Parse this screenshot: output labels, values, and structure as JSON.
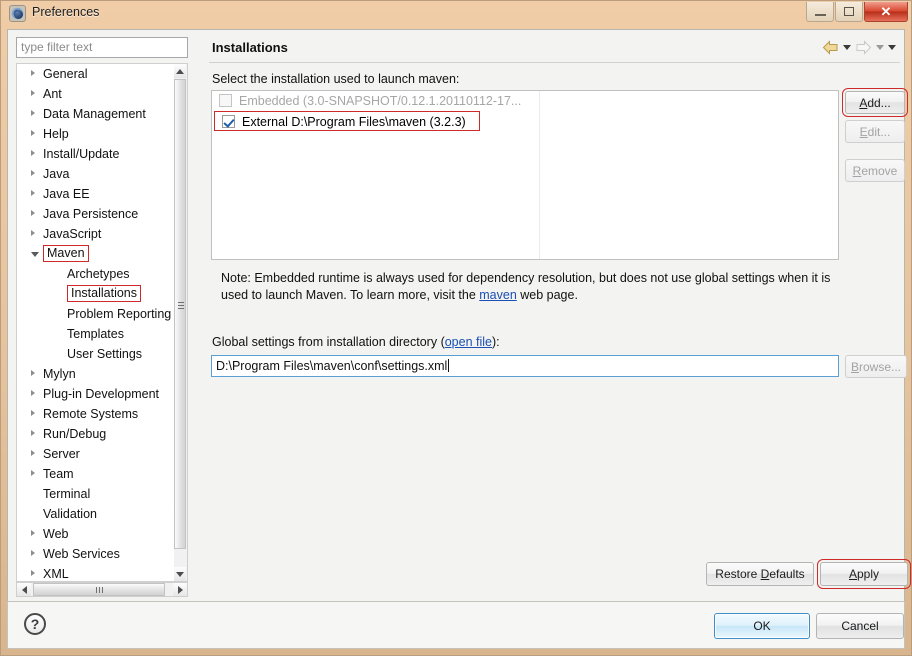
{
  "window": {
    "title": "Preferences",
    "icon": "preferences-icon",
    "minimize_label": "Minimize",
    "maximize_label": "Maximize",
    "close_label": "✕"
  },
  "sidebar": {
    "filter": {
      "placeholder": "type filter text",
      "value": ""
    },
    "tree": [
      {
        "label": "General",
        "indent": 0,
        "expandable": true,
        "expanded": false,
        "marked": false
      },
      {
        "label": "Ant",
        "indent": 0,
        "expandable": true,
        "expanded": false,
        "marked": false
      },
      {
        "label": "Data Management",
        "indent": 0,
        "expandable": true,
        "expanded": false,
        "marked": false
      },
      {
        "label": "Help",
        "indent": 0,
        "expandable": true,
        "expanded": false,
        "marked": false
      },
      {
        "label": "Install/Update",
        "indent": 0,
        "expandable": true,
        "expanded": false,
        "marked": false
      },
      {
        "label": "Java",
        "indent": 0,
        "expandable": true,
        "expanded": false,
        "marked": false
      },
      {
        "label": "Java EE",
        "indent": 0,
        "expandable": true,
        "expanded": false,
        "marked": false
      },
      {
        "label": "Java Persistence",
        "indent": 0,
        "expandable": true,
        "expanded": false,
        "marked": false
      },
      {
        "label": "JavaScript",
        "indent": 0,
        "expandable": true,
        "expanded": false,
        "marked": false
      },
      {
        "label": "Maven",
        "indent": 0,
        "expandable": true,
        "expanded": true,
        "marked": true
      },
      {
        "label": "Archetypes",
        "indent": 1,
        "expandable": false,
        "expanded": false,
        "marked": false
      },
      {
        "label": "Installations",
        "indent": 1,
        "expandable": false,
        "expanded": false,
        "marked": true
      },
      {
        "label": "Problem Reporting",
        "indent": 1,
        "expandable": false,
        "expanded": false,
        "marked": false
      },
      {
        "label": "Templates",
        "indent": 1,
        "expandable": false,
        "expanded": false,
        "marked": false
      },
      {
        "label": "User Settings",
        "indent": 1,
        "expandable": false,
        "expanded": false,
        "marked": false
      },
      {
        "label": "Mylyn",
        "indent": 0,
        "expandable": true,
        "expanded": false,
        "marked": false
      },
      {
        "label": "Plug-in Development",
        "indent": 0,
        "expandable": true,
        "expanded": false,
        "marked": false
      },
      {
        "label": "Remote Systems",
        "indent": 0,
        "expandable": true,
        "expanded": false,
        "marked": false
      },
      {
        "label": "Run/Debug",
        "indent": 0,
        "expandable": true,
        "expanded": false,
        "marked": false
      },
      {
        "label": "Server",
        "indent": 0,
        "expandable": true,
        "expanded": false,
        "marked": false
      },
      {
        "label": "Team",
        "indent": 0,
        "expandable": true,
        "expanded": false,
        "marked": false
      },
      {
        "label": "Terminal",
        "indent": 0,
        "expandable": false,
        "expanded": false,
        "marked": false
      },
      {
        "label": "Validation",
        "indent": 0,
        "expandable": false,
        "expanded": false,
        "marked": false
      },
      {
        "label": "Web",
        "indent": 0,
        "expandable": true,
        "expanded": false,
        "marked": false
      },
      {
        "label": "Web Services",
        "indent": 0,
        "expandable": true,
        "expanded": false,
        "marked": false
      },
      {
        "label": "XML",
        "indent": 0,
        "expandable": true,
        "expanded": false,
        "marked": false
      }
    ]
  },
  "page": {
    "title": "Installations",
    "nav": {
      "back_icon": "back-arrow-icon",
      "back_menu_icon": "chevron-down-icon",
      "forward_icon": "forward-arrow-icon",
      "forward_menu_icon": "chevron-down-icon",
      "menu_icon": "chevron-down-icon"
    },
    "select_label": "Select the installation used to launch maven:",
    "installations": [
      {
        "label": "Embedded (3.0-SNAPSHOT/0.12.1.20110112-17...",
        "checked": false,
        "enabled": false,
        "marked": false
      },
      {
        "label": "External D:\\Program Files\\maven (3.2.3)",
        "checked": true,
        "enabled": true,
        "marked": true
      }
    ],
    "buttons": {
      "add": "Add...",
      "add_mnemonic": "A",
      "edit": "Edit...",
      "edit_mnemonic": "E",
      "remove": "Remove",
      "remove_mnemonic": "R"
    },
    "note": {
      "part1": "Note: Embedded runtime is always used for dependency resolution, but does not use global settings when it is used to launch Maven. To learn more, visit the ",
      "link": "maven",
      "part2": " web page."
    },
    "global_settings": {
      "label_before": "Global settings from installation directory (",
      "link": "open file",
      "label_after": "):",
      "value": "D:\\Program Files\\maven\\conf\\settings.xml",
      "browse": "Browse...",
      "browse_mnemonic": "B"
    },
    "restore_defaults": "Restore Defaults",
    "restore_defaults_mnemonic": "D",
    "apply": "Apply",
    "apply_mnemonic": "A"
  },
  "footer": {
    "help_icon": "help-icon",
    "help_glyph": "?",
    "ok": "OK",
    "cancel": "Cancel"
  },
  "colors": {
    "frame": "#e6c39c",
    "annotation_red": "#cf2a2a",
    "link_blue": "#1a4fb4",
    "focus_blue": "#5a9fd4",
    "close_red": "#d9482f"
  }
}
